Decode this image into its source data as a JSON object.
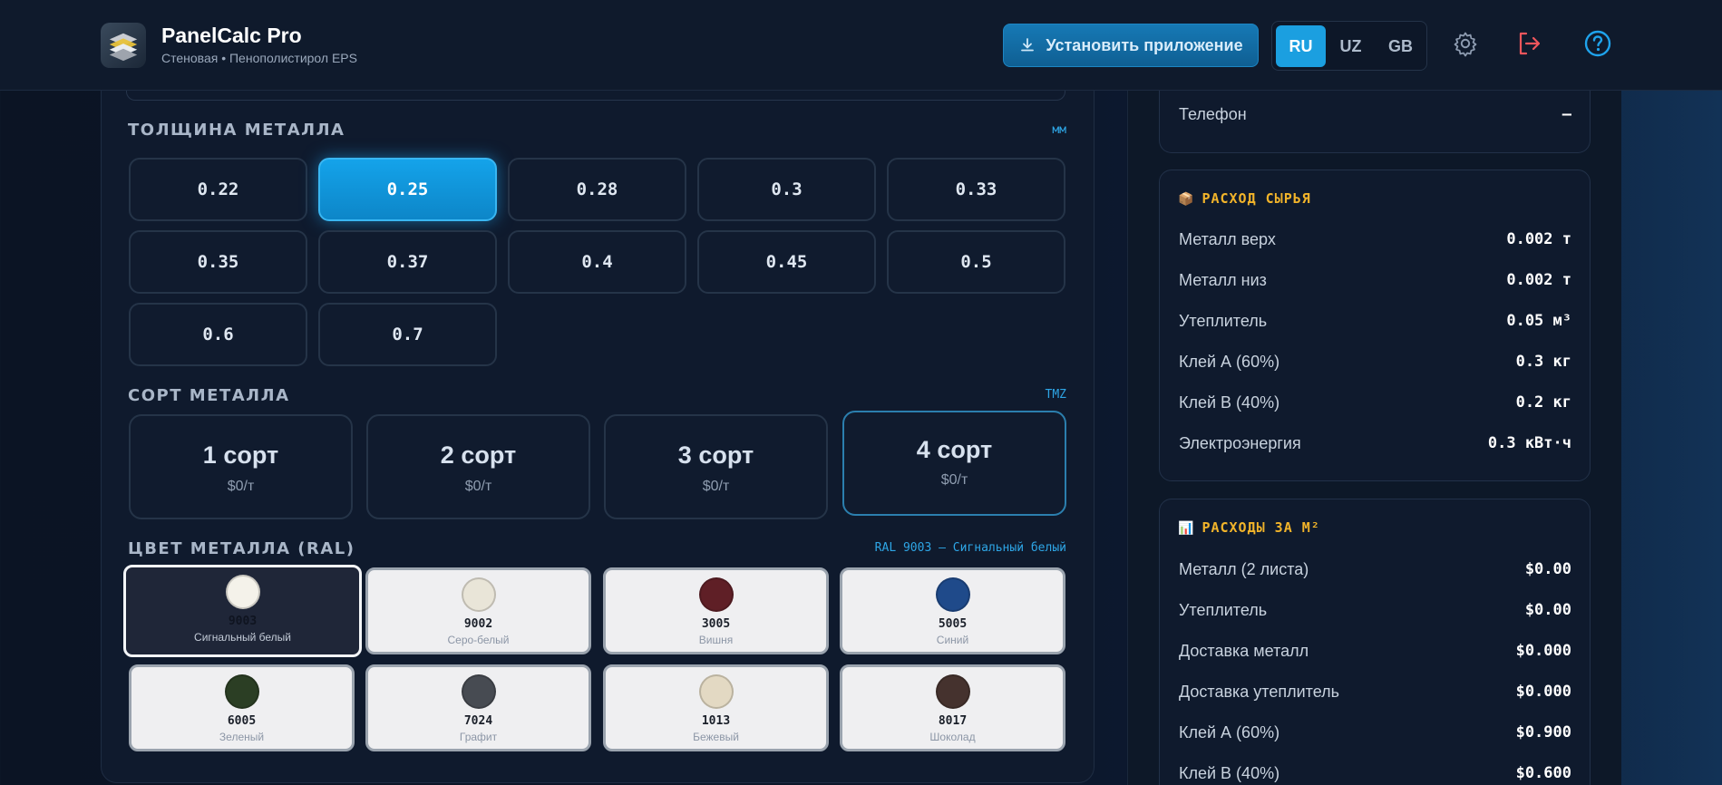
{
  "header": {
    "app_title": "PanelCalc Pro",
    "app_subtitle": "Стеновая • Пенополистирол EPS",
    "install_label": "Установить приложение",
    "languages": [
      "RU",
      "UZ",
      "GB"
    ],
    "active_language": "RU"
  },
  "thickness": {
    "title": "ТОЛЩИНА МЕТАЛЛА",
    "unit": "мм",
    "options": [
      "0.22",
      "0.25",
      "0.28",
      "0.3",
      "0.33",
      "0.35",
      "0.37",
      "0.4",
      "0.45",
      "0.5",
      "0.6",
      "0.7"
    ],
    "selected": "0.25"
  },
  "grade": {
    "title": "СОРТ МЕТАЛЛА",
    "supplier": "TMZ",
    "options": [
      {
        "name": "1 сорт",
        "price": "$0/т"
      },
      {
        "name": "2 сорт",
        "price": "$0/т"
      },
      {
        "name": "3 сорт",
        "price": "$0/т"
      },
      {
        "name": "4 сорт",
        "price": "$0/т"
      }
    ],
    "selected": "4 сорт"
  },
  "ral": {
    "title": "ЦВЕТ МЕТАЛЛА (RAL)",
    "selected_label": "RAL 9003 — Сигнальный белый",
    "colors": [
      {
        "code": "9003",
        "name": "Сигнальный белый",
        "hex": "#f4f2ea"
      },
      {
        "code": "9002",
        "name": "Серо-белый",
        "hex": "#e9e5d8"
      },
      {
        "code": "3005",
        "name": "Вишня",
        "hex": "#5f1f26"
      },
      {
        "code": "5005",
        "name": "Синий",
        "hex": "#1f4a8a"
      },
      {
        "code": "6005",
        "name": "Зеленый",
        "hex": "#2b3e24"
      },
      {
        "code": "7024",
        "name": "Графит",
        "hex": "#474b52"
      },
      {
        "code": "1013",
        "name": "Бежевый",
        "hex": "#e3d9c3"
      },
      {
        "code": "8017",
        "name": "Шоколад",
        "hex": "#45322e"
      }
    ],
    "selected": "9003"
  },
  "contact_card": {
    "phone_label": "Телефон",
    "phone_value": "—"
  },
  "raw_card": {
    "title": "РАСХОД СЫРЬЯ",
    "icon": "package-icon",
    "rows": [
      {
        "label": "Металл верх",
        "value": "0.002 т"
      },
      {
        "label": "Металл низ",
        "value": "0.002 т"
      },
      {
        "label": "Утеплитель",
        "value": "0.05 м³"
      },
      {
        "label": "Клей А (60%)",
        "value": "0.3 кг"
      },
      {
        "label": "Клей В (40%)",
        "value": "0.2 кг"
      },
      {
        "label": "Электроэнергия",
        "value": "0.3 кВт·ч"
      }
    ]
  },
  "cost_card": {
    "title": "РАСХОДЫ ЗА М²",
    "icon": "bar-chart-icon",
    "rows": [
      {
        "label": "Металл (2 листа)",
        "value": "$0.00"
      },
      {
        "label": "Утеплитель",
        "value": "$0.00"
      },
      {
        "label": "Доставка металл",
        "value": "$0.000"
      },
      {
        "label": "Доставка утеплитель",
        "value": "$0.000"
      },
      {
        "label": "Клей А (60%)",
        "value": "$0.900"
      },
      {
        "label": "Клей В (40%)",
        "value": "$0.600"
      }
    ]
  },
  "colors": {
    "accent": "#1b9fe0",
    "card_title": "#f2b42a",
    "logout": "#f0565c"
  }
}
